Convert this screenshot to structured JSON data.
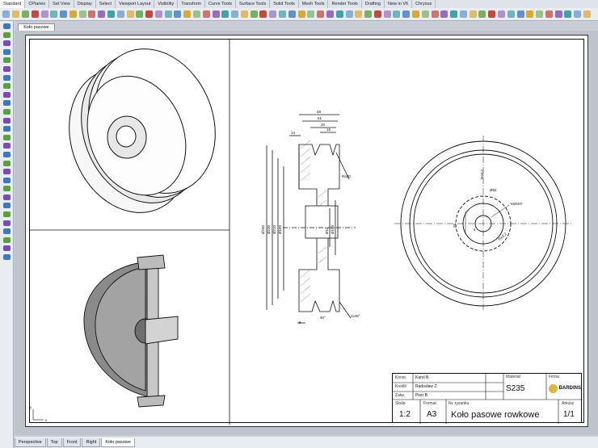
{
  "tabs": [
    "Standard",
    "CPlanes",
    "Set View",
    "Display",
    "Select",
    "Viewport Layout",
    "Visibility",
    "Transform",
    "Curve Tools",
    "Surface Tools",
    "Solid Tools",
    "Mesh Tools",
    "Render Tools",
    "Drafting",
    "New in V6",
    "Chrysus"
  ],
  "active_tab_index": 0,
  "viewport_tab": "Koło pasowe",
  "bottom_tabs": [
    "Perspective",
    "Top",
    "Front",
    "Right",
    "Koło pasowe"
  ],
  "active_bottom_tab_index": 4,
  "axis": {
    "x": "x",
    "y": "y"
  },
  "dimensions": {
    "top1": "58",
    "top2": "51",
    "top3": "20",
    "top4": "15",
    "left_small": "14",
    "d1": "Ø240",
    "d2": "Ø230",
    "d3": "Ø210",
    "d4": "Ø180",
    "d5": "Ø12",
    "d6": "Ø150",
    "ra": "Ra20",
    "chamfer": "1x45°",
    "angle": "40°",
    "bottom": "5"
  },
  "right_view": {
    "ra_top": "Ra3,2",
    "hole": "Ø52",
    "thread": "M25H7",
    "dim25": "25",
    "ra_bottom": "Ra3,2",
    "dim6": "6"
  },
  "title_block": {
    "konst_label": "Konst.",
    "konst_value": "Karol B.",
    "kreslil_label": "Kreślił",
    "kreslil_value": "Radosław Z.",
    "zatw_label": "Zatw.",
    "zatw_value": "Piotr B.",
    "material_label": "Materiał",
    "material_value": "S235",
    "firma_label": "Firma",
    "firma_value": "BARDINS",
    "skala_label": "Skala",
    "skala_value": "1:2",
    "format_label": "Format",
    "format_value": "A3",
    "nr_label": "Nr. rysunku",
    "title": "Koło pasowe rowkowe",
    "arkusz_label": "Arkusz",
    "arkusz_value": "1/1"
  },
  "colors": {
    "toolbar_icons": [
      "#3a78c2",
      "#d9a21c",
      "#5aa13b",
      "#c7342b",
      "#7a4bb8",
      "#2e9aa8"
    ]
  }
}
